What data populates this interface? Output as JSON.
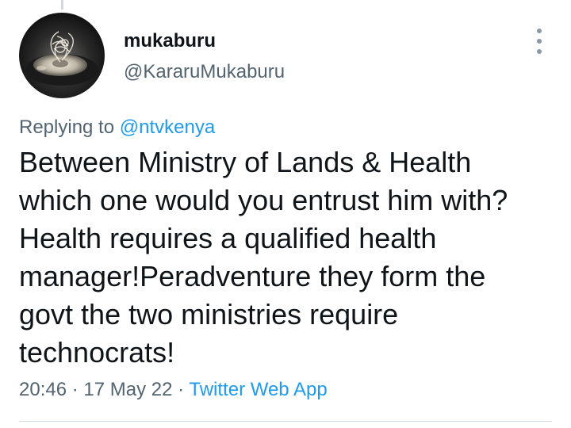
{
  "user": {
    "display_name": "mukaburu",
    "handle": "@KararuMukaburu"
  },
  "reply": {
    "prefix": "Replying to",
    "mention": "@ntvkenya"
  },
  "tweet": {
    "text": "Between Ministry of Lands & Health\nwhich one would you entrust him with?\nHealth requires a qualified health\nmanager!Peradventure they form the\ngovt the two ministries require\ntechnocrats!"
  },
  "meta": {
    "time": "20:46",
    "separator": "·",
    "date": "17 May 22",
    "source": "Twitter Web App"
  },
  "icons": {
    "more": "more-options-icon",
    "avatar": "profile-photo"
  },
  "colors": {
    "link": "#1d9bf0",
    "secondary_text": "#536471",
    "primary_text": "#0f1419"
  }
}
